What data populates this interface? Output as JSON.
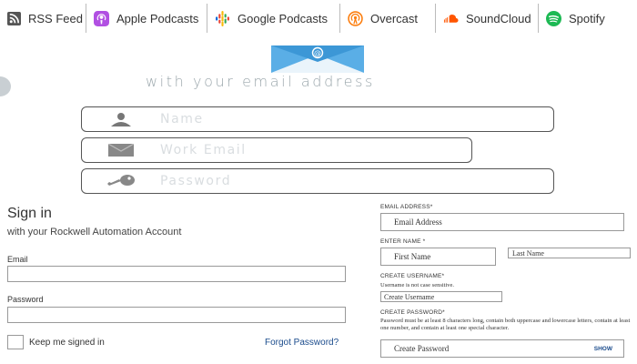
{
  "platforms": [
    {
      "label": "RSS Feed",
      "icon": "rss-icon",
      "color": "#555555"
    },
    {
      "label": "Apple Podcasts",
      "icon": "apple-podcasts-icon",
      "color": "#b150e2"
    },
    {
      "label": "Google Podcasts",
      "icon": "google-podcasts-icon",
      "color": "#4285f4"
    },
    {
      "label": "Overcast",
      "icon": "overcast-icon",
      "color": "#fc7e0f"
    },
    {
      "label": "SoundCloud",
      "icon": "soundcloud-icon",
      "color": "#ff5500"
    },
    {
      "label": "Spotify",
      "icon": "spotify-icon",
      "color": "#1db954"
    }
  ],
  "banner": {
    "icon": "envelope-at-icon",
    "tagline": "with your email address",
    "fields": [
      {
        "placeholder": "Name",
        "icon": "person-icon"
      },
      {
        "placeholder": "Work Email",
        "icon": "envelope-icon"
      },
      {
        "placeholder": "Password",
        "icon": "key-icon"
      }
    ]
  },
  "signin": {
    "title": "Sign in",
    "subtitle": "with your Rockwell Automation Account",
    "email_label": "Email",
    "email_value": "",
    "password_label": "Password",
    "password_value": "",
    "keep_signed_in": "Keep me signed in",
    "forgot_password": "Forgot Password?"
  },
  "register": {
    "email_label": "EMAIL ADDRESS*",
    "email_placeholder": "Email Address",
    "name_label": "ENTER NAME *",
    "first_placeholder": "First Name",
    "last_placeholder": "Last Name",
    "username_label": "CREATE USERNAME*",
    "username_hint": "Username is not case sensitive.",
    "username_placeholder": "Create Username",
    "password_label": "CREATE PASSWORD*",
    "password_hint": "Password must be at least 8 characters long, contain both uppercase and lowercase letters, contain at least one number, and contain at least one special character.",
    "password_placeholder": "Create Password",
    "show_label": "SHOW"
  },
  "colors": {
    "link": "#1a4b8c",
    "envelope": "#5aaee6",
    "tagline": "#9aa6ab"
  }
}
